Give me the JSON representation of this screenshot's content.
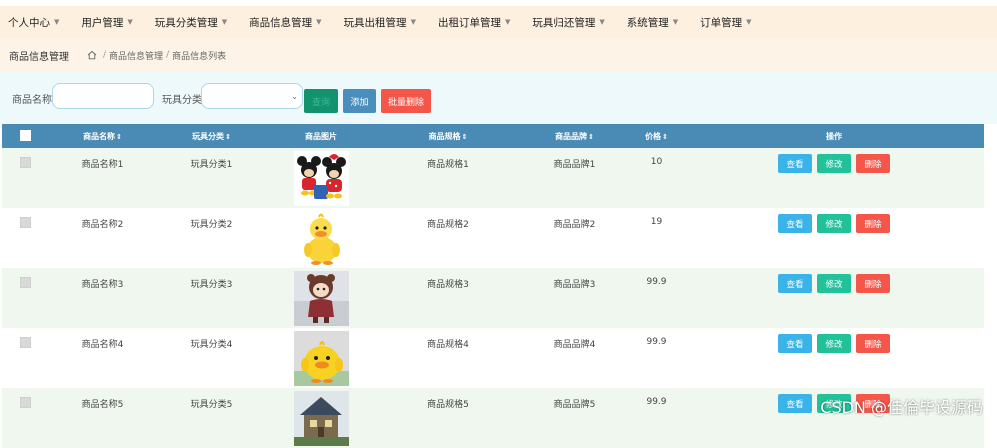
{
  "colors": {
    "nav_bg": "#fdf0df",
    "header_bg": "#4a8bb5",
    "view": "#3ab4e8",
    "edit": "#21c29a",
    "delete": "#f5564a",
    "search": "#13926f",
    "add": "#4b8dbb",
    "batch_delete": "#f5564a"
  },
  "nav": [
    {
      "label": "个人中心",
      "icon": "caret-down-icon"
    },
    {
      "label": "用户管理",
      "icon": "caret-down-icon"
    },
    {
      "label": "玩具分类管理",
      "icon": "caret-down-icon"
    },
    {
      "label": "商品信息管理",
      "icon": "caret-down-icon"
    },
    {
      "label": "玩具出租管理",
      "icon": "caret-down-icon"
    },
    {
      "label": "出租订单管理",
      "icon": "caret-down-icon"
    },
    {
      "label": "玩具归还管理",
      "icon": "caret-down-icon"
    },
    {
      "label": "系统管理",
      "icon": "caret-down-icon"
    },
    {
      "label": "订单管理",
      "icon": "caret-down-icon"
    }
  ],
  "breadcrumb": {
    "title": "商品信息管理",
    "items": [
      "商品信息管理",
      "商品信息列表"
    ],
    "separator": "/",
    "icon": "home-icon"
  },
  "search": {
    "name_label": "商品名称",
    "name_value": "",
    "category_label": "玩具分类",
    "category_value": "",
    "search_button": "查询",
    "add_button": "添加",
    "batch_delete_button": "批量删除"
  },
  "table": {
    "headers": [
      "商品名称",
      "玩具分类",
      "商品图片",
      "商品规格",
      "商品品牌",
      "价格",
      "操作"
    ],
    "sort_icon": "sort-icon",
    "actions": {
      "view": "查看",
      "edit": "修改",
      "delete": "删除"
    },
    "rows": [
      {
        "name": "商品名称1",
        "category": "玩具分类1",
        "image": "mickey-minnie-plush",
        "spec": "商品规格1",
        "brand": "商品品牌1",
        "price": "10"
      },
      {
        "name": "商品名称2",
        "category": "玩具分类2",
        "image": "yellow-duck-plush",
        "spec": "商品规格2",
        "brand": "商品品牌2",
        "price": "19"
      },
      {
        "name": "商品名称3",
        "category": "玩具分类3",
        "image": "doll-plush",
        "spec": "商品规格3",
        "brand": "商品品牌3",
        "price": "99.9"
      },
      {
        "name": "商品名称4",
        "category": "玩具分类4",
        "image": "yellow-chick-plush",
        "spec": "商品规格4",
        "brand": "商品品牌4",
        "price": "99.9"
      },
      {
        "name": "商品名称5",
        "category": "玩具分类5",
        "image": "house-toy",
        "spec": "商品规格5",
        "brand": "商品品牌5",
        "price": "99.9"
      }
    ]
  },
  "watermark": "CSDN @佳倫毕设源码"
}
